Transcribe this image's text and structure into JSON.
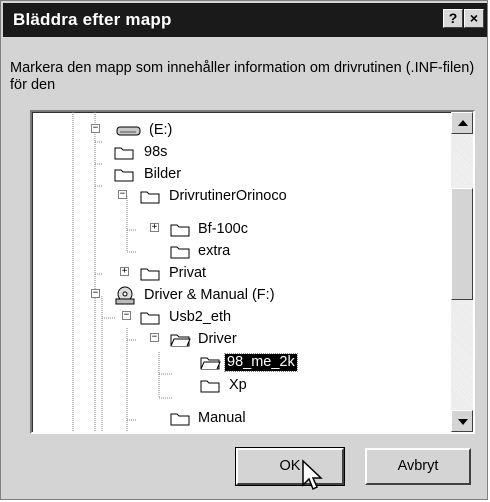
{
  "dialog": {
    "title": "Bläddra efter mapp",
    "help_label": "?",
    "close_label": "×",
    "instruction": "Markera den mapp som innehåller information om drivrutinen (.INF-filen) för den"
  },
  "tree": {
    "items": [
      {
        "label": "(E:)",
        "icon": "drive-icon",
        "expander": "−"
      },
      {
        "label": "98s",
        "icon": "folder-icon"
      },
      {
        "label": "Bilder",
        "icon": "folder-icon"
      },
      {
        "label": "DrivrutinerOrinoco",
        "icon": "folder-icon",
        "expander": "−"
      },
      {
        "label": "Bf-100c",
        "icon": "folder-icon",
        "expander": "+"
      },
      {
        "label": "extra",
        "icon": "folder-icon"
      },
      {
        "label": "Privat",
        "icon": "folder-icon",
        "expander": "+"
      },
      {
        "label": "Driver & Manual (F:)",
        "icon": "cd-drive-icon",
        "expander": "−"
      },
      {
        "label": "Usb2_eth",
        "icon": "folder-icon",
        "expander": "−"
      },
      {
        "label": "Driver",
        "icon": "open-folder-icon",
        "expander": "−"
      },
      {
        "label": "98_me_2k",
        "icon": "open-folder-icon",
        "selected": true
      },
      {
        "label": "Xp",
        "icon": "folder-icon"
      },
      {
        "label": "Manual",
        "icon": "folder-icon"
      }
    ]
  },
  "buttons": {
    "ok_label": "OK",
    "cancel_label": "Avbryt"
  },
  "colors": {
    "titlebar": "#1a1a1a",
    "dialog_bg": "#d4d4d4",
    "selection": "#000000"
  }
}
